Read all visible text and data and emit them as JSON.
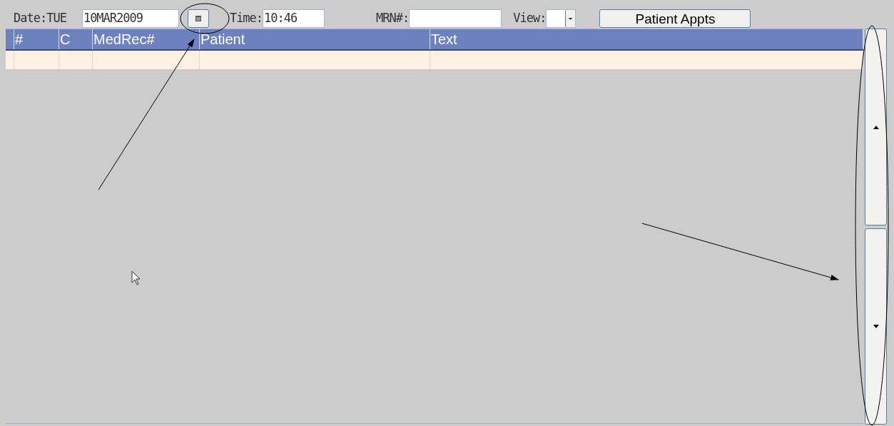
{
  "toolbar": {
    "date_label": "Date:TUE",
    "date": "10MAR2009",
    "time_label": "Time:",
    "time": "10:46",
    "mrn_label": "MRN#:",
    "view_label": "View:",
    "button": "Patient Appts"
  },
  "table": {
    "columns": [
      "#",
      "C",
      "MedRec#",
      "Patient",
      "Text"
    ]
  }
}
